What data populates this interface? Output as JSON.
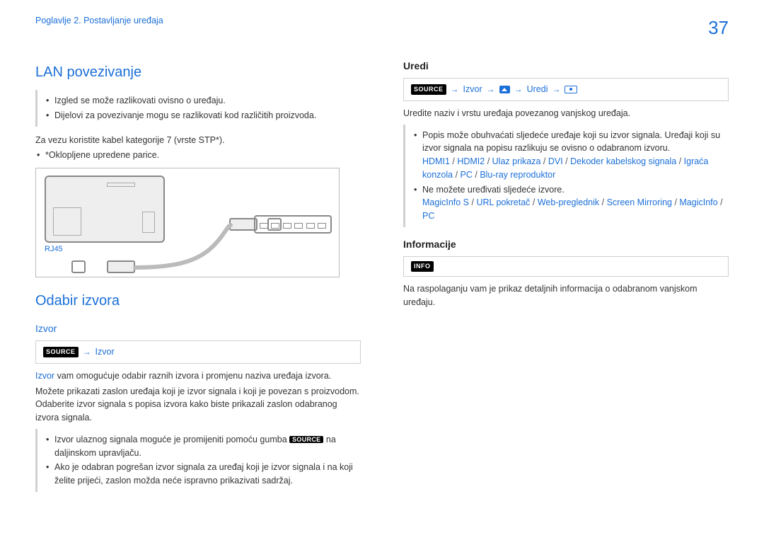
{
  "header": {
    "chapter": "Poglavlje 2. Postavljanje uređaja",
    "page": "37"
  },
  "left": {
    "h_lan": "LAN povezivanje",
    "note1": "Izgled se može razlikovati ovisno o uređaju.",
    "note2": "Dijelovi za povezivanje mogu se razlikovati kod različitih proizvoda.",
    "p1": "Za vezu koristite kabel kategorije 7 (vrste STP*).",
    "p1a": "*Oklopljene upredene parice.",
    "rj45": "RJ45",
    "h_odabir": "Odabir izvora",
    "h_izvor": "Izvor",
    "nav_source": "SOURCE",
    "nav_izvor": "Izvor",
    "izvor_p1a": "Izvor",
    "izvor_p1b": " vam omogućuje odabir raznih izvora i promjenu naziva uređaja izvora.",
    "izvor_p2": "Možete prikazati zaslon uređaja koji je izvor signala i koji je povezan s proizvodom. Odaberite izvor signala s popisa izvora kako biste prikazali zaslon odabranog izvora signala.",
    "li1_a": "Izvor ulaznog signala moguće je promijeniti pomoću gumba ",
    "li1_src": "SOURCE",
    "li1_b": " na daljinskom upravljaču.",
    "li2": "Ako je odabran pogrešan izvor signala za uređaj koji je izvor signala i na koji želite prijeći, zaslon možda neće ispravno prikazivati sadržaj."
  },
  "right": {
    "h_uredi": "Uredi",
    "nav_source": "SOURCE",
    "nav_izvor": "Izvor",
    "nav_uredi": "Uredi",
    "p1": "Uredite naziv i vrstu uređaja povezanog vanjskog uređaja.",
    "li1": "Popis može obuhvaćati sljedeće uređaje koji su izvor signala. Uređaji koji su izvor signala na popisu razlikuju se ovisno o odabranom izvoru.",
    "links1": [
      "HDMI1",
      "HDMI2",
      "Ulaz prikaza",
      "DVI",
      "Dekoder kabelskog signala",
      "Igraća konzola",
      "PC",
      "Blu-ray reproduktor"
    ],
    "li2": "Ne možete uređivati sljedeće izvore.",
    "links2": [
      "MagicInfo S",
      "URL pokretač",
      "Web-preglednik",
      "Screen Mirroring",
      "MagicInfo",
      "PC"
    ],
    "h_info": "Informacije",
    "nav_info": "INFO",
    "p_info": "Na raspolaganju vam je prikaz detaljnih informacija o odabranom vanjskom uređaju."
  }
}
